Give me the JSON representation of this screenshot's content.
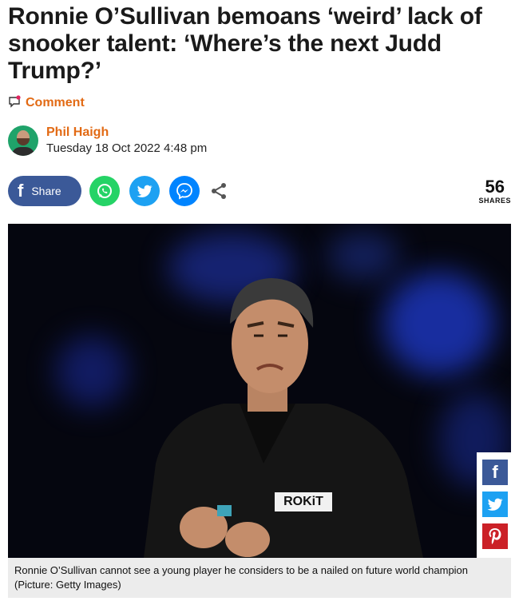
{
  "article": {
    "headline": "Ronnie O’Sullivan bemoans ‘weird’ lack of snooker talent: ‘Where’s the next Judd Trump?’",
    "comment_label": "Comment",
    "author_name": "Phil Haigh",
    "date": "Tuesday 18 Oct 2022 4:48 pm"
  },
  "share_bar": {
    "facebook_label": "Share",
    "count": "56",
    "count_label": "SHARES",
    "buttons": [
      "facebook-icon",
      "whatsapp-icon",
      "twitter-icon",
      "messenger-icon",
      "share-icon"
    ]
  },
  "image": {
    "jersey_text": "ROKiT",
    "caption": "Ronnie O’Sullivan cannot see a young player he considers to be a nailed on future world champion (Picture: Getty Images)"
  },
  "side_share": {
    "buttons": [
      "facebook-icon",
      "twitter-icon",
      "pinterest-icon"
    ],
    "colors": {
      "facebook": "#3b5998",
      "twitter": "#1da1f2",
      "pinterest": "#cb2027"
    }
  },
  "colors": {
    "accent": "#e26a14",
    "facebook": "#3b5998",
    "whatsapp": "#25d366",
    "twitter": "#1da1f2",
    "messenger": "#0084ff"
  }
}
